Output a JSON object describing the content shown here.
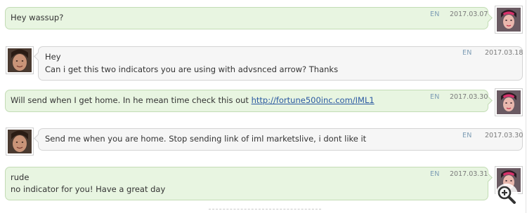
{
  "colors": {
    "sent_bubble": "#e8f5e1",
    "received_bubble": "#f6f6f6",
    "link": "#2a58a0",
    "lang": "#7c9cb4"
  },
  "messages": [
    {
      "side": "right",
      "avatar": "woman-avatar",
      "lines": [
        "Hey wassup?"
      ],
      "lang": "EN",
      "date": "2017.03.07"
    },
    {
      "side": "left",
      "avatar": "man-avatar",
      "lines": [
        "Hey",
        "Can i get this two indicators you are using with advsnced arrow? Thanks"
      ],
      "lang": "EN",
      "date": "2017.03.18"
    },
    {
      "side": "right",
      "avatar": "woman-avatar",
      "text_before_link": "Will send when I get home. In he mean time check this out ",
      "link_text": "http://fortune500inc.com/IML1",
      "lang": "EN",
      "date": "2017.03.30"
    },
    {
      "side": "left",
      "avatar": "man-avatar",
      "lines": [
        "Send me when you are home. Stop sending link of iml marketslive, i dont like it"
      ],
      "lang": "EN",
      "date": "2017.03.30"
    },
    {
      "side": "right",
      "avatar": "woman-avatar",
      "lines": [
        "rude",
        "no indicator for you! Have a great day"
      ],
      "lang": "EN",
      "date": "2017.03.31"
    }
  ]
}
